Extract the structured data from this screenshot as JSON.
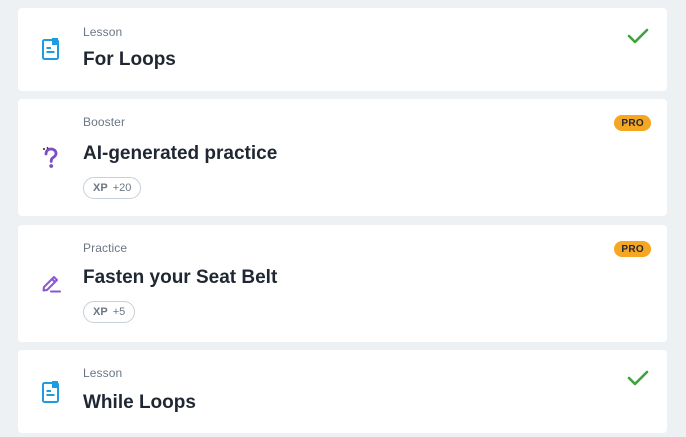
{
  "items": [
    {
      "type": "Lesson",
      "title": "For Loops",
      "icon": "lesson-icon",
      "completed": true
    },
    {
      "type": "Booster",
      "title": "AI-generated practice",
      "icon": "booster-icon",
      "badge": "PRO",
      "xp_label": "XP",
      "xp_value": "+20"
    },
    {
      "type": "Practice",
      "title": "Fasten your Seat Belt",
      "icon": "practice-icon",
      "badge": "PRO",
      "xp_label": "XP",
      "xp_value": "+5"
    },
    {
      "type": "Lesson",
      "title": "While Loops",
      "icon": "lesson-icon",
      "completed": true
    }
  ],
  "colors": {
    "lesson_icon": "#1f9be0",
    "booster_icon": "#7c4dc4",
    "practice_icon": "#8a56d6",
    "check": "#3ea33b",
    "pro_badge": "#f5a623"
  }
}
